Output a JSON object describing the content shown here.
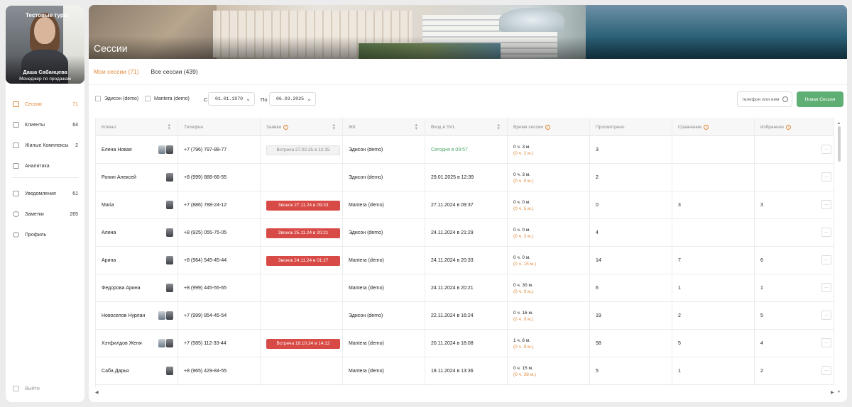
{
  "sidebar": {
    "org": "Тестовые туры",
    "user_name": "Даша Сабанцева",
    "user_role": "Менеджер по продажам",
    "nav": [
      {
        "label": "Сессии",
        "count": "71",
        "icon": "monitor-icon",
        "active": true
      },
      {
        "label": "Клиенты",
        "count": "64",
        "icon": "sofa-icon"
      },
      {
        "label": "Жилые Комплексы",
        "count": "2",
        "icon": "building-icon"
      },
      {
        "label": "Аналитика",
        "count": "",
        "icon": "chart-icon"
      },
      {
        "label": "Уведомления",
        "count": "61",
        "icon": "bell-icon"
      },
      {
        "label": "Заметки",
        "count": "265",
        "icon": "plus-circle-icon"
      },
      {
        "label": "Профиль",
        "count": "",
        "icon": "user-icon"
      }
    ],
    "logout": "Выйти"
  },
  "banner": {
    "title": "Сессии"
  },
  "tabs": [
    {
      "label": "Мои сессии (71)",
      "active": true
    },
    {
      "label": "Все сессии (439)"
    }
  ],
  "filters": {
    "check1": "Эдисон (demo)",
    "check2": "Mantera (demo)",
    "from_label": "С",
    "from_value": "01.01.1970",
    "to_label": "По",
    "to_value": "06.03.2025",
    "search_placeholder": "телефон или имя",
    "new_button": "Новая Сессия"
  },
  "columns": [
    "Клиент",
    "Телефон",
    "Заявки",
    "ЖК",
    "Вход в SVL",
    "Время сессии",
    "Просмотрено",
    "Сравнение",
    "Избранное"
  ],
  "more_label": "···",
  "rows": [
    {
      "client": "Елена Новая",
      "phone": "+7 (796) 797-88-77",
      "req": "Встреча 27.02.25 в 12:15",
      "req_type": "gray",
      "zk": "Эдисон (demo)",
      "enter": "Сегодня в 09:57",
      "enter_green": true,
      "time1": "0 ч. 3 м.",
      "time2": "(0 ч. 2 м.)",
      "viewed": "3",
      "cmp": "",
      "fav": "",
      "avatars": 2
    },
    {
      "client": "Ронин Алексей",
      "phone": "+8 (999) 888-66-55",
      "req": "",
      "req_type": "",
      "zk": "Эдисон (demo)",
      "enter": "29.01.2025 в 12:39",
      "time1": "0 ч. 3 м.",
      "time2": "(0 ч. 0 м.)",
      "viewed": "2",
      "cmp": "",
      "fav": "",
      "avatars": 1
    },
    {
      "client": "Maria",
      "phone": "+7 (886) 788-24-12",
      "req": "Звонок 27.11.24 в 09:33",
      "req_type": "red",
      "zk": "Mantera (demo)",
      "enter": "27.11.2024 в 09:37",
      "time1": "0 ч. 0 м.",
      "time2": "(0 ч. 5 м.)",
      "viewed": "0",
      "cmp": "3",
      "fav": "3",
      "avatars": 1
    },
    {
      "client": "Алина",
      "phone": "+8 (925) 055-75-05",
      "req": "Звонок 25.11.24 в 20:21",
      "req_type": "red",
      "zk": "Эдисон (demo)",
      "enter": "24.11.2024 в 21:29",
      "time1": "0 ч. 0 м.",
      "time2": "(0 ч. 3 м.)",
      "viewed": "4",
      "cmp": "",
      "fav": "",
      "avatars": 1
    },
    {
      "client": "Арина",
      "phone": "+8 (964) 545-45-44",
      "req": "Звонок 24.11.24 в 01:27",
      "req_type": "red",
      "zk": "Mantera (demo)",
      "enter": "24.11.2024 в 20:33",
      "time1": "0 ч. 0 м.",
      "time2": "(0 ч. 15 м.)",
      "viewed": "14",
      "cmp": "7",
      "fav": "6",
      "avatars": 1
    },
    {
      "client": "Федорова Арина",
      "phone": "+8 (999) 445-55-65",
      "req": "",
      "req_type": "",
      "zk": "Mantera (demo)",
      "enter": "24.11.2024 в 20:21",
      "time1": "0 ч. 30 м.",
      "time2": "(0 ч. 0 м.)",
      "viewed": "6",
      "cmp": "1",
      "fav": "1",
      "avatars": 1
    },
    {
      "client": "Новоселов Нурлан",
      "phone": "+7 (999) 854-45-54",
      "req": "",
      "req_type": "",
      "zk": "Эдисон (demo)",
      "enter": "22.11.2024 в 16:24",
      "time1": "0 ч. 16 м.",
      "time2": "(0 ч. 0 м.)",
      "viewed": "19",
      "cmp": "2",
      "fav": "5",
      "avatars": 2
    },
    {
      "client": "Хэтфилдов Женя",
      "phone": "+7 (585) 112-33-44",
      "req": "Встреча 18.10.24 в 14:12",
      "req_type": "red",
      "zk": "Mantera (demo)",
      "enter": "20.11.2024 в 18:08",
      "time1": "1 ч. 6 м.",
      "time2": "(0 ч. 9 м.)",
      "viewed": "58",
      "cmp": "5",
      "fav": "4",
      "avatars": 2
    },
    {
      "client": "Саба Дарья",
      "phone": "+8 (965) 429-84-55",
      "req": "",
      "req_type": "",
      "zk": "Mantera (demo)",
      "enter": "18.11.2024 в 13:36",
      "time1": "0 ч. 15 м.",
      "time2": "(0 ч. 38 м.)",
      "viewed": "5",
      "cmp": "1",
      "fav": "2",
      "avatars": 1
    }
  ]
}
